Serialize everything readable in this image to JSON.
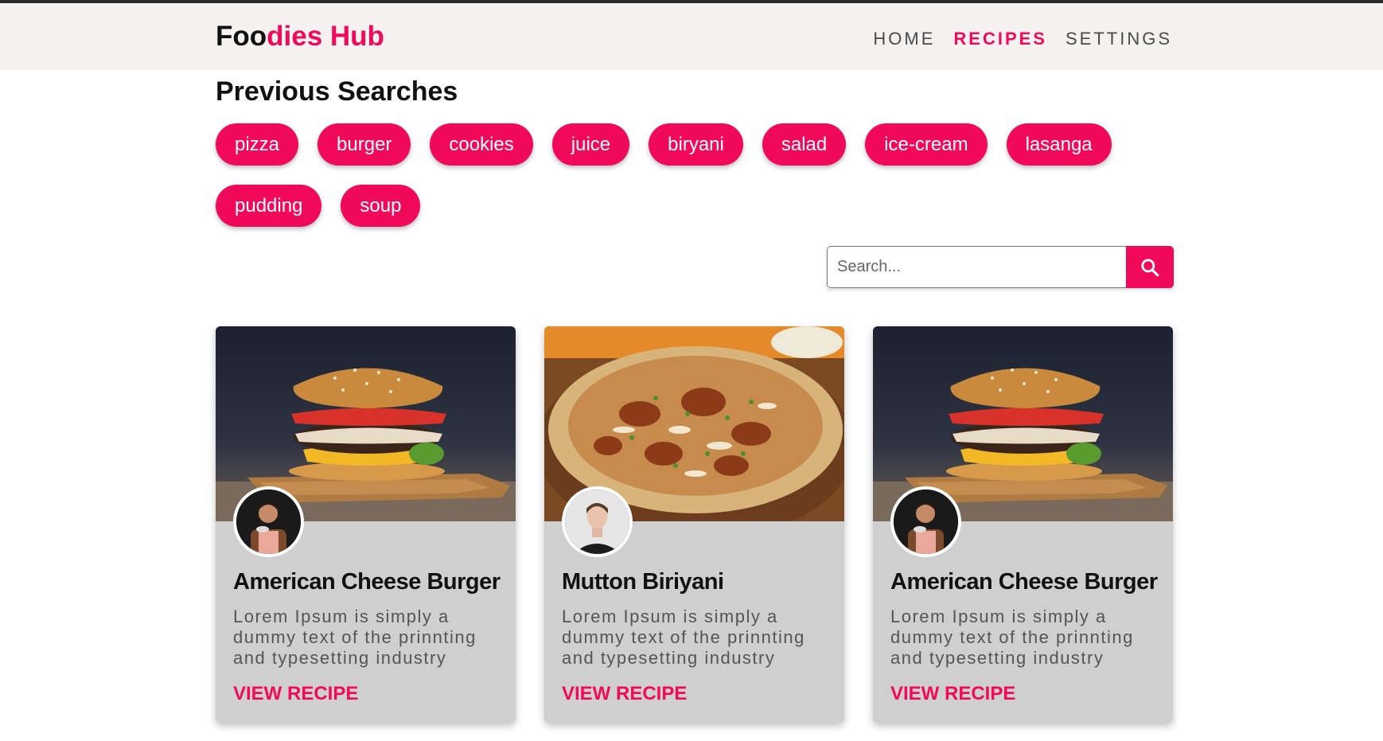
{
  "header": {
    "logo_part1": "Foo",
    "logo_part2": "dies Hub",
    "nav": [
      {
        "label": "HOME",
        "active": false
      },
      {
        "label": "RECIPES",
        "active": true
      },
      {
        "label": "SETTINGS",
        "active": false
      }
    ]
  },
  "previous_searches": {
    "title": "Previous Searches",
    "chips": [
      "pizza",
      "burger",
      "cookies",
      "juice",
      "biryani",
      "salad",
      "ice-cream",
      "lasanga",
      "pudding",
      "soup"
    ]
  },
  "search": {
    "placeholder": "Search...",
    "value": "",
    "icon": "search-icon"
  },
  "cards": [
    {
      "title": "American Cheese Burger",
      "description": "Lorem Ipsum is simply a dummy text of the prinnting and typesetting industry",
      "link": "VIEW RECIPE",
      "image": "burger-photo",
      "avatar": "chef-avatar"
    },
    {
      "title": "Mutton Biriyani",
      "description": "Lorem Ipsum is simply a dummy text of the prinnting and typesetting industry",
      "link": "VIEW RECIPE",
      "image": "biryani-photo",
      "avatar": "man-avatar"
    },
    {
      "title": "American Cheese Burger",
      "description": "Lorem Ipsum is simply a dummy text of the prinnting and typesetting industry",
      "link": "VIEW RECIPE",
      "image": "burger-photo",
      "avatar": "chef-avatar"
    }
  ],
  "colors": {
    "accent": "#f20a5a",
    "header_bg": "#f4f1f0",
    "card_bg": "#cfcfcf"
  }
}
